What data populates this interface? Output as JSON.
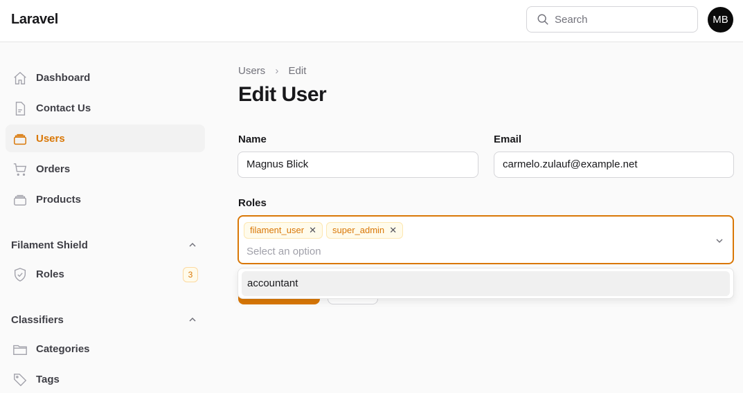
{
  "header": {
    "brand": "Laravel",
    "search_placeholder": "Search",
    "avatar_initials": "MB"
  },
  "sidebar": {
    "items": [
      {
        "label": "Dashboard",
        "icon": "home-icon"
      },
      {
        "label": "Contact Us",
        "icon": "document-icon"
      },
      {
        "label": "Users",
        "icon": "stack-icon",
        "active": true
      },
      {
        "label": "Orders",
        "icon": "cart-icon"
      },
      {
        "label": "Products",
        "icon": "stack-icon"
      }
    ],
    "groups": [
      {
        "label": "Filament Shield",
        "items": [
          {
            "label": "Roles",
            "badge": "3",
            "icon": "shield-check-icon"
          }
        ]
      },
      {
        "label": "Classifiers",
        "items": [
          {
            "label": "Categories",
            "icon": "folder-icon"
          },
          {
            "label": "Tags",
            "icon": "tag-icon"
          }
        ]
      }
    ]
  },
  "breadcrumb": [
    "Users",
    "Edit"
  ],
  "page_title": "Edit User",
  "form": {
    "name_label": "Name",
    "name_value": "Magnus Blick",
    "email_label": "Email",
    "email_value": "carmelo.zulauf@example.net",
    "roles_label": "Roles",
    "roles_selected": [
      "filament_user",
      "super_admin"
    ],
    "roles_placeholder": "Select an option",
    "roles_options": [
      "accountant"
    ]
  },
  "colors": {
    "accent": "#d97706"
  }
}
